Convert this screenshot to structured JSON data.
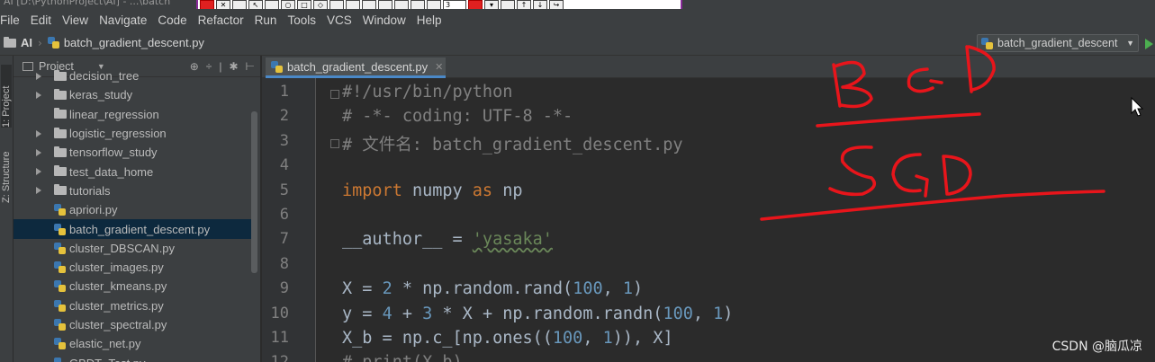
{
  "window": {
    "title_fragment": "AI [D:\\PythonProject\\AI] - ...\\batch"
  },
  "annotation_toolbar": {
    "line_width": "3"
  },
  "menu": [
    "File",
    "Edit",
    "View",
    "Navigate",
    "Code",
    "Refactor",
    "Run",
    "Tools",
    "VCS",
    "Window",
    "Help"
  ],
  "navbar": {
    "project": "AI",
    "file": "batch_gradient_descent.py",
    "run_config": "batch_gradient_descent"
  },
  "side_tabs": {
    "project": "1: Project",
    "structure": "Z: Structure"
  },
  "project_panel": {
    "title": "Project",
    "items": [
      {
        "label": "decision_tree",
        "type": "folder",
        "expandable": true
      },
      {
        "label": "keras_study",
        "type": "folder",
        "expandable": true
      },
      {
        "label": "linear_regression",
        "type": "folder",
        "expandable": false
      },
      {
        "label": "logistic_regression",
        "type": "folder",
        "expandable": true
      },
      {
        "label": "tensorflow_study",
        "type": "folder",
        "expandable": true
      },
      {
        "label": "test_data_home",
        "type": "folder",
        "expandable": true
      },
      {
        "label": "tutorials",
        "type": "folder",
        "expandable": true
      },
      {
        "label": "apriori.py",
        "type": "py",
        "expandable": false
      },
      {
        "label": "batch_gradient_descent.py",
        "type": "py",
        "expandable": false,
        "selected": true
      },
      {
        "label": "cluster_DBSCAN.py",
        "type": "py",
        "expandable": false
      },
      {
        "label": "cluster_images.py",
        "type": "py",
        "expandable": false
      },
      {
        "label": "cluster_kmeans.py",
        "type": "py",
        "expandable": false
      },
      {
        "label": "cluster_metrics.py",
        "type": "py",
        "expandable": false
      },
      {
        "label": "cluster_spectral.py",
        "type": "py",
        "expandable": false
      },
      {
        "label": "elastic_net.py",
        "type": "py",
        "expandable": false
      },
      {
        "label": "GBDT_Test.py",
        "type": "py",
        "expandable": false
      }
    ]
  },
  "editor": {
    "tab": "batch_gradient_descent.py",
    "lines": [
      {
        "n": "1",
        "tokens": [
          [
            "com",
            "#!/usr/bin/python"
          ]
        ]
      },
      {
        "n": "2",
        "tokens": [
          [
            "com",
            "# -*- coding: UTF-8 -*-"
          ]
        ]
      },
      {
        "n": "3",
        "tokens": [
          [
            "com",
            "# 文件名: batch_gradient_descent.py"
          ]
        ]
      },
      {
        "n": "4",
        "tokens": []
      },
      {
        "n": "5",
        "tokens": [
          [
            "kw",
            "import"
          ],
          [
            "txt",
            " numpy "
          ],
          [
            "kw",
            "as"
          ],
          [
            "txt",
            " np"
          ]
        ]
      },
      {
        "n": "6",
        "tokens": []
      },
      {
        "n": "7",
        "tokens": [
          [
            "txt",
            "__author__ = "
          ],
          [
            "str",
            "'yasaka'"
          ]
        ]
      },
      {
        "n": "8",
        "tokens": []
      },
      {
        "n": "9",
        "tokens": [
          [
            "txt",
            "X = "
          ],
          [
            "num",
            "2"
          ],
          [
            "txt",
            " * np.random.rand("
          ],
          [
            "num",
            "100"
          ],
          [
            "txt",
            ", "
          ],
          [
            "num",
            "1"
          ],
          [
            "txt",
            ")"
          ]
        ]
      },
      {
        "n": "10",
        "tokens": [
          [
            "txt",
            "y = "
          ],
          [
            "num",
            "4"
          ],
          [
            "txt",
            " + "
          ],
          [
            "num",
            "3"
          ],
          [
            "txt",
            " * X + np.random.randn("
          ],
          [
            "num",
            "100"
          ],
          [
            "txt",
            ", "
          ],
          [
            "num",
            "1"
          ],
          [
            "txt",
            ")"
          ]
        ]
      },
      {
        "n": "11",
        "tokens": [
          [
            "txt",
            "X_b = np.c_[np.ones(("
          ],
          [
            "num",
            "100"
          ],
          [
            "txt",
            ", "
          ],
          [
            "num",
            "1"
          ],
          [
            "txt",
            ")), X]"
          ]
        ]
      },
      {
        "n": "12",
        "tokens": [
          [
            "com",
            "# print(X_b)"
          ]
        ]
      }
    ]
  },
  "annotations": {
    "top": "BGD",
    "bottom": "SGD"
  },
  "watermark": "CSDN @脑瓜凉",
  "colors": {
    "accent": "#4a88c7",
    "ink": "#e8151b",
    "selection": "#0d293e"
  }
}
